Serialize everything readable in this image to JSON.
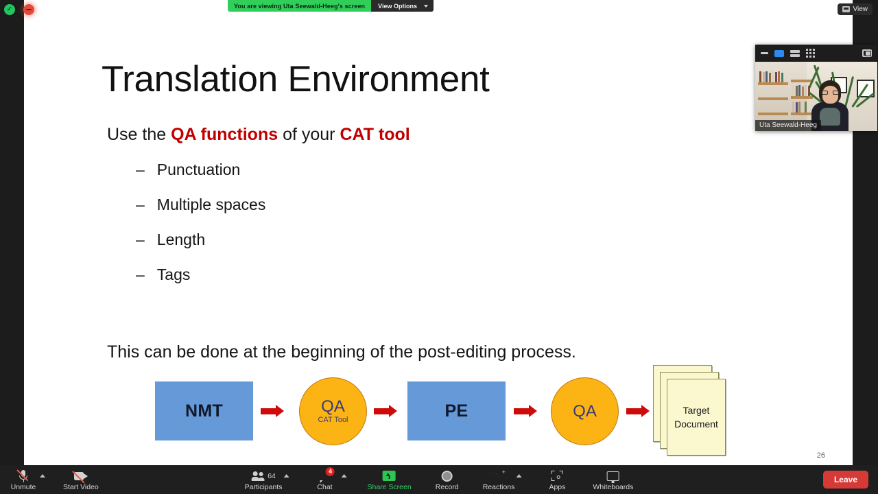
{
  "meeting": {
    "share_banner": {
      "viewing_text": "You are viewing Uta Seewald-Heeg's screen",
      "view_options_label": "View Options",
      "banner_color": "#2fcf5a"
    },
    "view_pill": {
      "label": "View"
    },
    "status_icons": {
      "secure": "shield-check-icon",
      "recording": "recording-stopped-icon"
    }
  },
  "self_view": {
    "participant_name": "Uta Seewald-Heeg",
    "toolbar_icons": [
      "minimize-icon",
      "speaker-view-icon",
      "gallery-rows-icon",
      "grid-view-icon",
      "popout-icon"
    ],
    "active_view": "speaker-view-icon",
    "active_color": "#2b8cf0"
  },
  "slide": {
    "title": "Translation Environment",
    "lead": {
      "before": "Use the ",
      "highlight1": "QA functions",
      "middle": " of your ",
      "highlight2": "CAT tool"
    },
    "bullets": [
      {
        "dash": "–",
        "text": "Punctuation"
      },
      {
        "dash": "–",
        "text": "Multiple spaces"
      },
      {
        "dash": "–",
        "text": "Length"
      },
      {
        "dash": "–",
        "text": "Tags"
      }
    ],
    "closing": "This can be done at the beginning of the post-editing process.",
    "page_number": "26",
    "highlight_color": "#c00000"
  },
  "diagram": {
    "type": "process-flow",
    "box_color": "#6699D8",
    "circle_color": "#FBB413",
    "arrow_color": "#cf0a0a",
    "doc_color": "#FBF8D0",
    "nodes": [
      {
        "kind": "box",
        "label": "NMT"
      },
      {
        "kind": "arrow"
      },
      {
        "kind": "circle",
        "label": "QA",
        "sub": "CAT Tool"
      },
      {
        "kind": "arrow"
      },
      {
        "kind": "box",
        "label": "PE"
      },
      {
        "kind": "arrow"
      },
      {
        "kind": "circle",
        "label": "QA",
        "sub": ""
      },
      {
        "kind": "arrow"
      },
      {
        "kind": "docs",
        "label_line1": "Target",
        "label_line2": "Document"
      }
    ]
  },
  "toolbar": {
    "left": [
      {
        "name": "unmute",
        "label": "Unmute",
        "icon": "microphone-muted-icon",
        "has_chevron": true
      },
      {
        "name": "start-video",
        "label": "Start Video",
        "icon": "camera-off-icon",
        "has_chevron": false
      }
    ],
    "center": [
      {
        "name": "participants",
        "label": "Participants",
        "icon": "participants-icon",
        "count": "64",
        "has_chevron": true
      },
      {
        "name": "chat",
        "label": "Chat",
        "icon": "chat-icon",
        "badge": "4",
        "has_chevron": true
      },
      {
        "name": "share-screen",
        "label": "Share Screen",
        "icon": "share-screen-icon",
        "green": true
      },
      {
        "name": "record",
        "label": "Record",
        "icon": "record-icon"
      },
      {
        "name": "reactions",
        "label": "Reactions",
        "icon": "reactions-icon",
        "has_chevron": true
      },
      {
        "name": "apps",
        "label": "Apps",
        "icon": "apps-icon"
      },
      {
        "name": "whiteboards",
        "label": "Whiteboards",
        "icon": "whiteboard-icon"
      }
    ],
    "leave_label": "Leave",
    "leave_color": "#d63a36"
  }
}
